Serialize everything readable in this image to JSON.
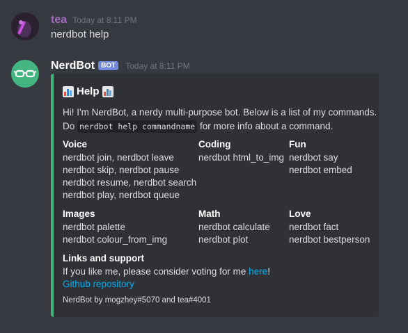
{
  "messages": [
    {
      "author": "tea",
      "timestamp": "Today at 8:11 PM",
      "content": "nerdbot help"
    },
    {
      "author": "NerdBot",
      "badge": "BOT",
      "timestamp": "Today at 8:11 PM"
    }
  ],
  "embed": {
    "accent_color": "#43b581",
    "title": "Help",
    "title_icon": "bar-chart-icon",
    "description_before": "Hi! I'm NerdBot, a nerdy multi-purpose bot. Below is a list of my commands.",
    "description_do": "Do",
    "description_code": "nerdbot help commandname",
    "description_after": "for more info about a command.",
    "fields": [
      {
        "name": "Voice",
        "lines": [
          "nerdbot join, nerdbot leave",
          "nerdbot skip, nerdbot pause",
          "nerdbot resume, nerdbot search",
          "nerdbot play, nerdbot queue"
        ]
      },
      {
        "name": "Coding",
        "lines": [
          "nerdbot html_to_img"
        ]
      },
      {
        "name": "Fun",
        "lines": [
          "nerdbot say",
          "nerdbot embed"
        ]
      },
      {
        "name": "Images",
        "lines": [
          "nerdbot palette",
          "nerdbot colour_from_img"
        ]
      },
      {
        "name": "Math",
        "lines": [
          "nerdbot calculate",
          "nerdbot plot"
        ]
      },
      {
        "name": "Love",
        "lines": [
          "nerdbot fact",
          "nerdbot bestperson"
        ]
      }
    ],
    "links": {
      "name": "Links and support",
      "vote_before": "If you like me, please consider voting for me",
      "vote_link": "here",
      "vote_after": "!",
      "github": "Github repository"
    },
    "footer": "NerdBot by mogzhey#5070 and tea#4001"
  },
  "colors": {
    "background": "#36393f",
    "embed_bg": "#2f3136",
    "link": "#00b0f4",
    "tea_name": "#a66bc4"
  }
}
